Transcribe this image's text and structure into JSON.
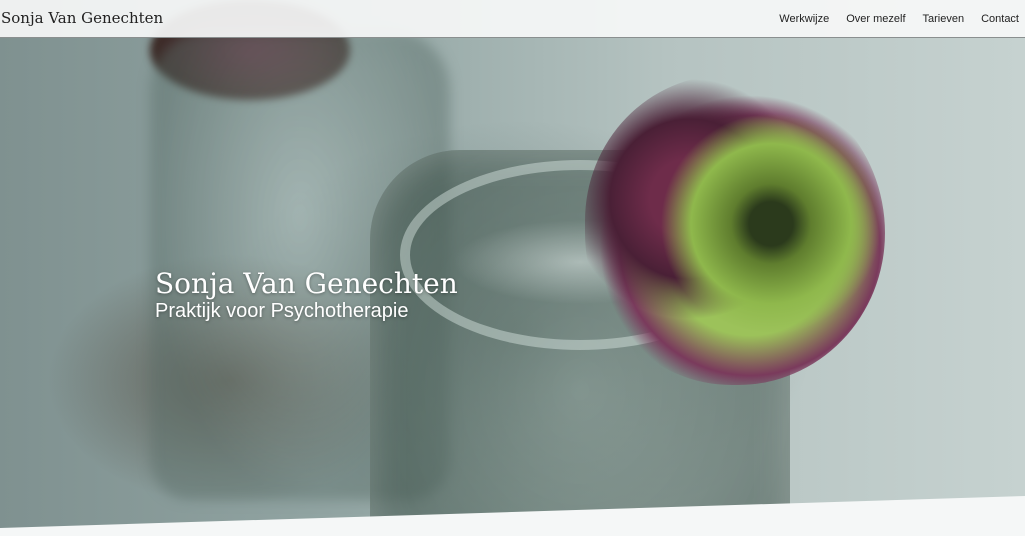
{
  "navbar": {
    "brand": "Sonja Van Genechten",
    "links": [
      "Werkwijze",
      "Over mezelf",
      "Tarieven",
      "Contact"
    ]
  },
  "hero": {
    "title": "Sonja Van Genechten",
    "subtitle": "Praktijk voor Psychotherapie",
    "image": "flower-in-glass-jar"
  }
}
